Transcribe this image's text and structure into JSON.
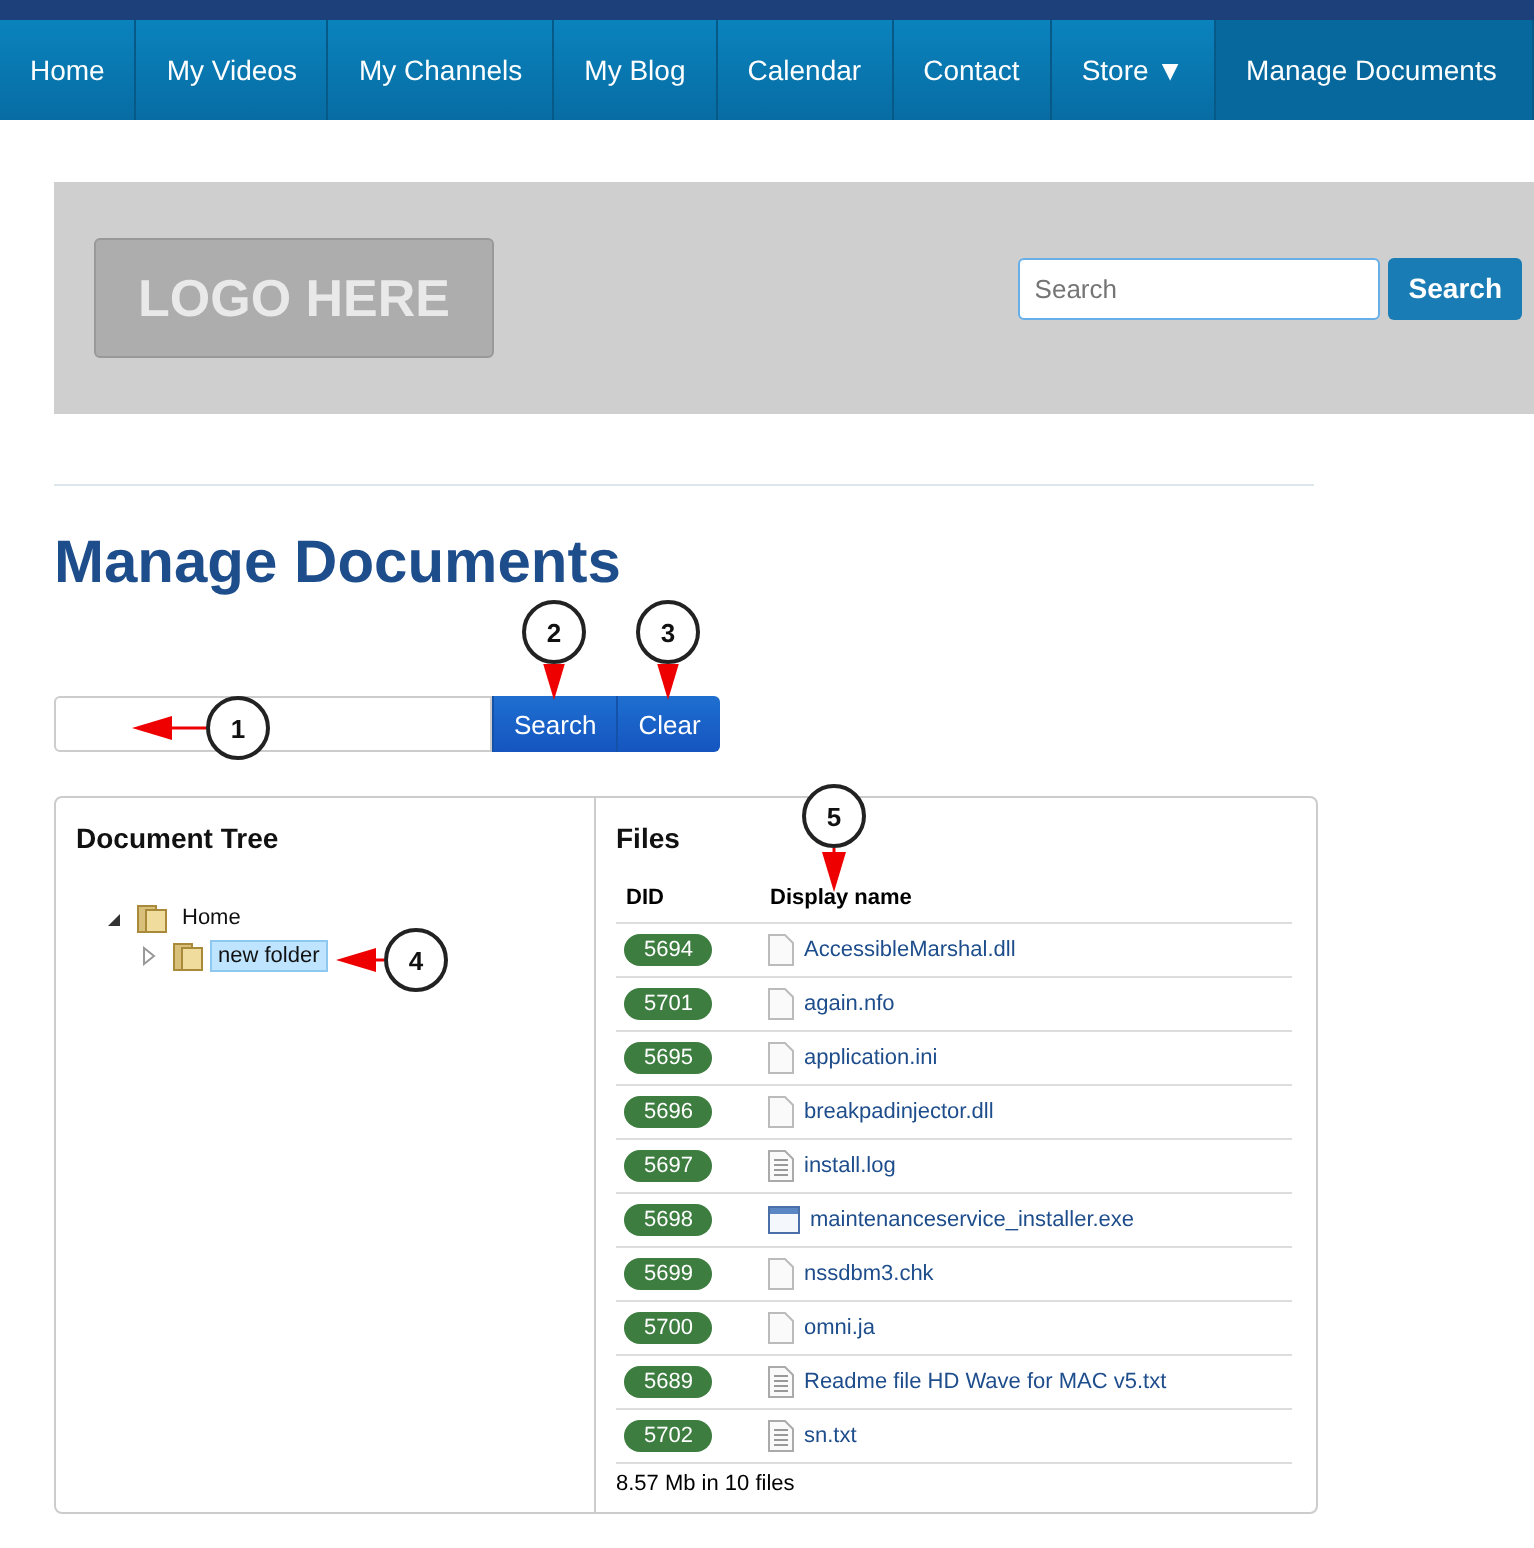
{
  "nav": [
    {
      "label": "Home",
      "selected": false
    },
    {
      "label": "My Videos",
      "selected": false
    },
    {
      "label": "My Channels",
      "selected": false
    },
    {
      "label": "My Blog",
      "selected": false
    },
    {
      "label": "Calendar",
      "selected": false
    },
    {
      "label": "Contact",
      "selected": false
    },
    {
      "label": "Store ▼",
      "selected": false
    },
    {
      "label": "Manage Documents",
      "selected": true
    }
  ],
  "header": {
    "logo": "LOGO HERE",
    "search": {
      "placeholder": "Search"
    },
    "search_button": "Search"
  },
  "title": "Manage Documents",
  "doc_search": {
    "search_button": "Search",
    "clear_button": "Clear"
  },
  "tree": {
    "title": "Document Tree",
    "items": [
      {
        "label": "Home",
        "selected": false,
        "expanded": true,
        "children": [
          {
            "label": "new folder",
            "selected": true,
            "expanded": false
          }
        ]
      }
    ]
  },
  "files": {
    "title": "Files",
    "columns": [
      "DID",
      "Display name"
    ],
    "rows": [
      {
        "did": "5694",
        "name": "AccessibleMarshal.dll",
        "kind": "blank"
      },
      {
        "did": "5701",
        "name": "again.nfo",
        "kind": "blank"
      },
      {
        "did": "5695",
        "name": "application.ini",
        "kind": "blank"
      },
      {
        "did": "5696",
        "name": "breakpadinjector.dll",
        "kind": "blank"
      },
      {
        "did": "5697",
        "name": "install.log",
        "kind": "text"
      },
      {
        "did": "5698",
        "name": "maintenanceservice_installer.exe",
        "kind": "window"
      },
      {
        "did": "5699",
        "name": "nssdbm3.chk",
        "kind": "blank"
      },
      {
        "did": "5700",
        "name": "omni.ja",
        "kind": "blank"
      },
      {
        "did": "5689",
        "name": "Readme file HD Wave for MAC v5.txt",
        "kind": "text"
      },
      {
        "did": "5702",
        "name": "sn.txt",
        "kind": "text"
      }
    ],
    "summary": "8.57 Mb in 10 files"
  },
  "callouts": [
    {
      "label": "1",
      "kind": "left"
    },
    {
      "label": "2",
      "kind": "down"
    },
    {
      "label": "3",
      "kind": "down"
    },
    {
      "label": "4",
      "kind": "left"
    },
    {
      "label": "5",
      "kind": "down"
    }
  ]
}
